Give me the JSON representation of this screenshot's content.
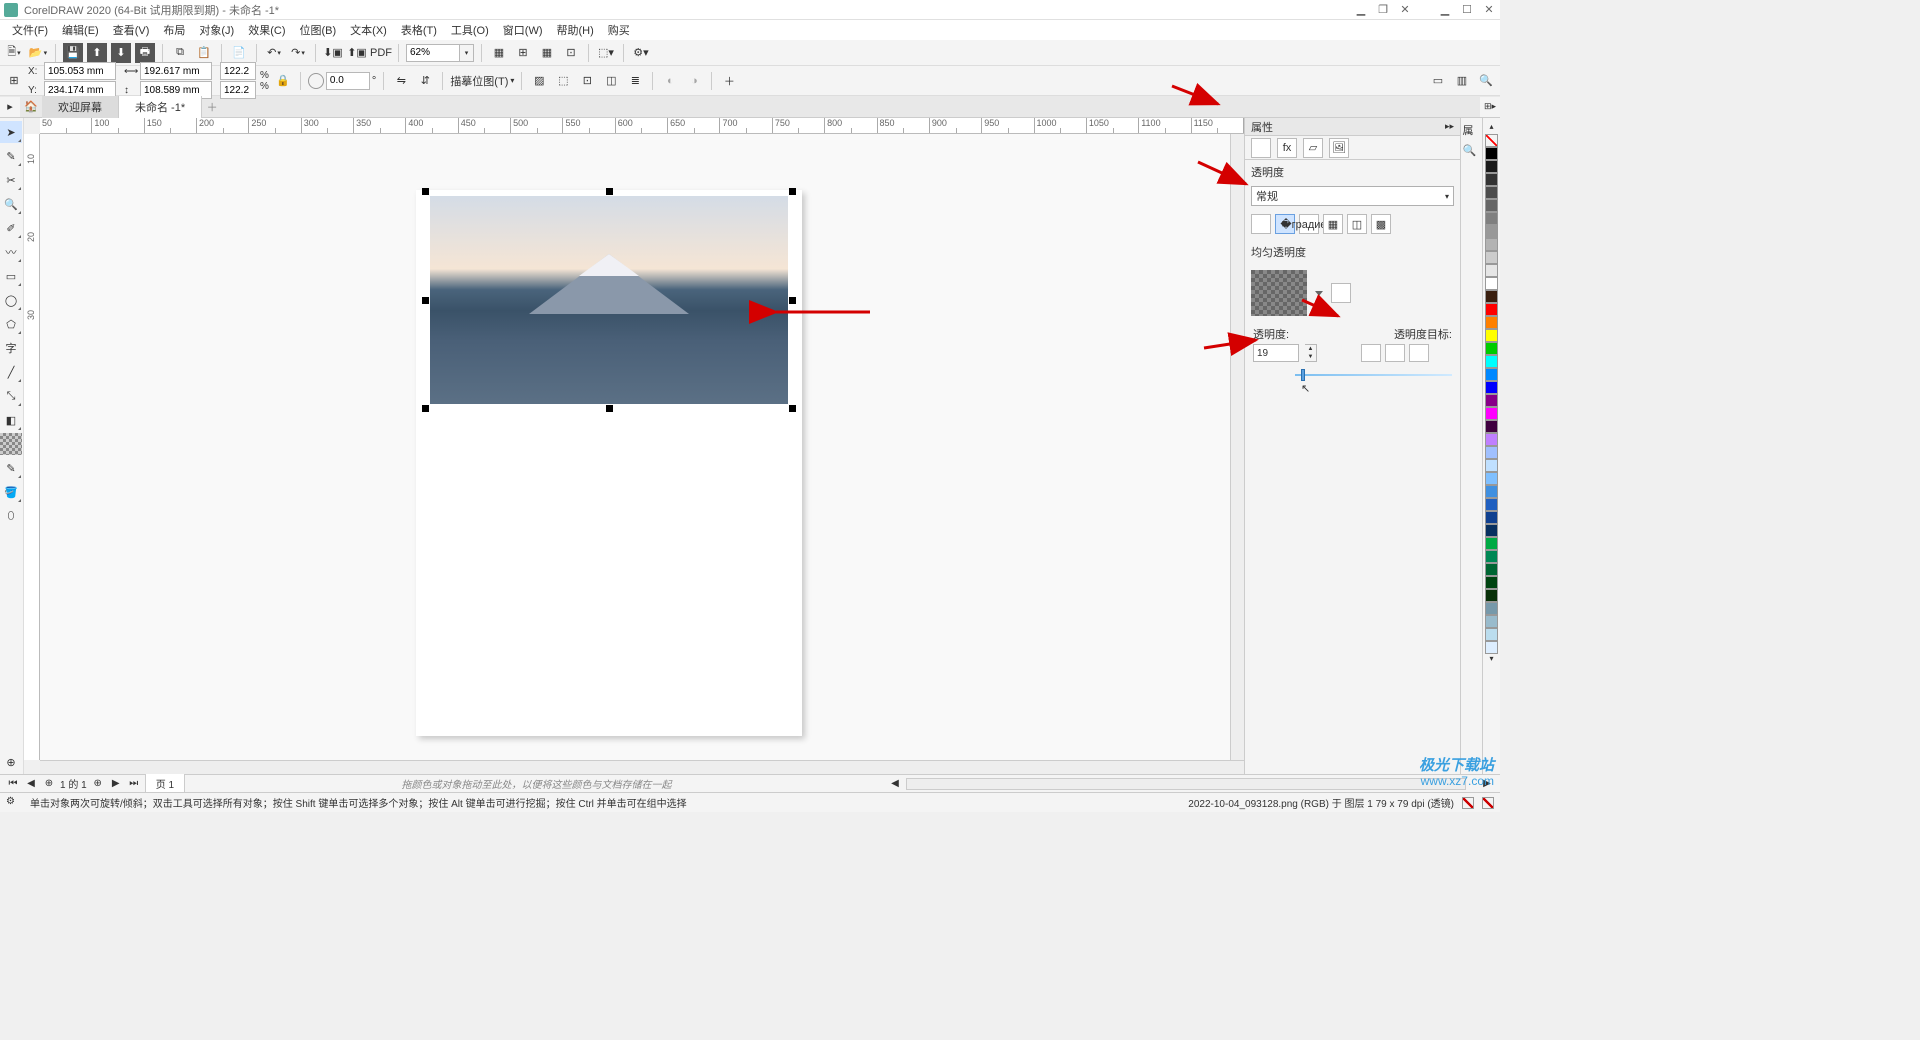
{
  "title": "CorelDRAW 2020 (64-Bit 试用期限到期) - 未命名 -1*",
  "menu": [
    "文件(F)",
    "编辑(E)",
    "查看(V)",
    "布局",
    "对象(J)",
    "效果(C)",
    "位图(B)",
    "文本(X)",
    "表格(T)",
    "工具(O)",
    "窗口(W)",
    "帮助(H)",
    "购买"
  ],
  "toolbar": {
    "zoom": "62%"
  },
  "propbar": {
    "x": "105.053 mm",
    "y": "234.174 mm",
    "w": "192.617 mm",
    "h": "108.589 mm",
    "sx": "122.2",
    "sy": "122.2",
    "rot": "0.0",
    "trace": "描摹位图(T)"
  },
  "tabs": {
    "welcome": "欢迎屏幕",
    "doc": "未命名 -1*"
  },
  "ruler_h": [
    "50",
    "100",
    "150",
    "200",
    "250",
    "300",
    "350",
    "400",
    "450",
    "500",
    "550",
    "600",
    "650",
    "700",
    "750",
    "800",
    "850",
    "900",
    "950",
    "1000",
    "1050",
    "1100",
    "1150"
  ],
  "panel": {
    "title": "属性",
    "section": "透明度",
    "mode": "常规",
    "uniform": "均匀透明度",
    "opacity_label": "透明度:",
    "opacity_value": "19",
    "target_label": "透明度目标:"
  },
  "pagenav": {
    "page": "页 1",
    "hint": "拖颜色或对象拖动至此处，以便将这些颜色与文档存储在一起"
  },
  "colorhint": {
    "none1": "无",
    "none2": "无"
  },
  "status": {
    "left": "单击对象两次可旋转/倾斜；双击工具可选择所有对象；按住 Shift 键单击可选择多个对象；按住 Alt 键单击可进行挖掘；按住 Ctrl 并单击可在组中选择",
    "right": "2022-10-04_093128.png (RGB) 于 图层 1 79 x 79 dpi (透镜)"
  },
  "palette": [
    "#000",
    "#1a1a1a",
    "#333",
    "#4d4d4d",
    "#666",
    "#808080",
    "#999",
    "#b3b3b3",
    "#ccc",
    "#e6e6e6",
    "#fff",
    "#3a1f0f",
    "#f00",
    "#ff8000",
    "#ff0",
    "#0c0",
    "#0ff",
    "#08f",
    "#00f",
    "#808",
    "#f0f",
    "#400040",
    "#c080ff",
    "#a0c0ff",
    "#c0e0ff",
    "#80c0ff",
    "#4090e0",
    "#2060c0",
    "#104090",
    "#083060",
    "#0a4",
    "#085",
    "#063",
    "#041",
    "#083008",
    "#79a",
    "#9bc",
    "#bde",
    "#def"
  ],
  "watermark": {
    "l1": "极光下载站",
    "l2": "www.xz7.com"
  }
}
